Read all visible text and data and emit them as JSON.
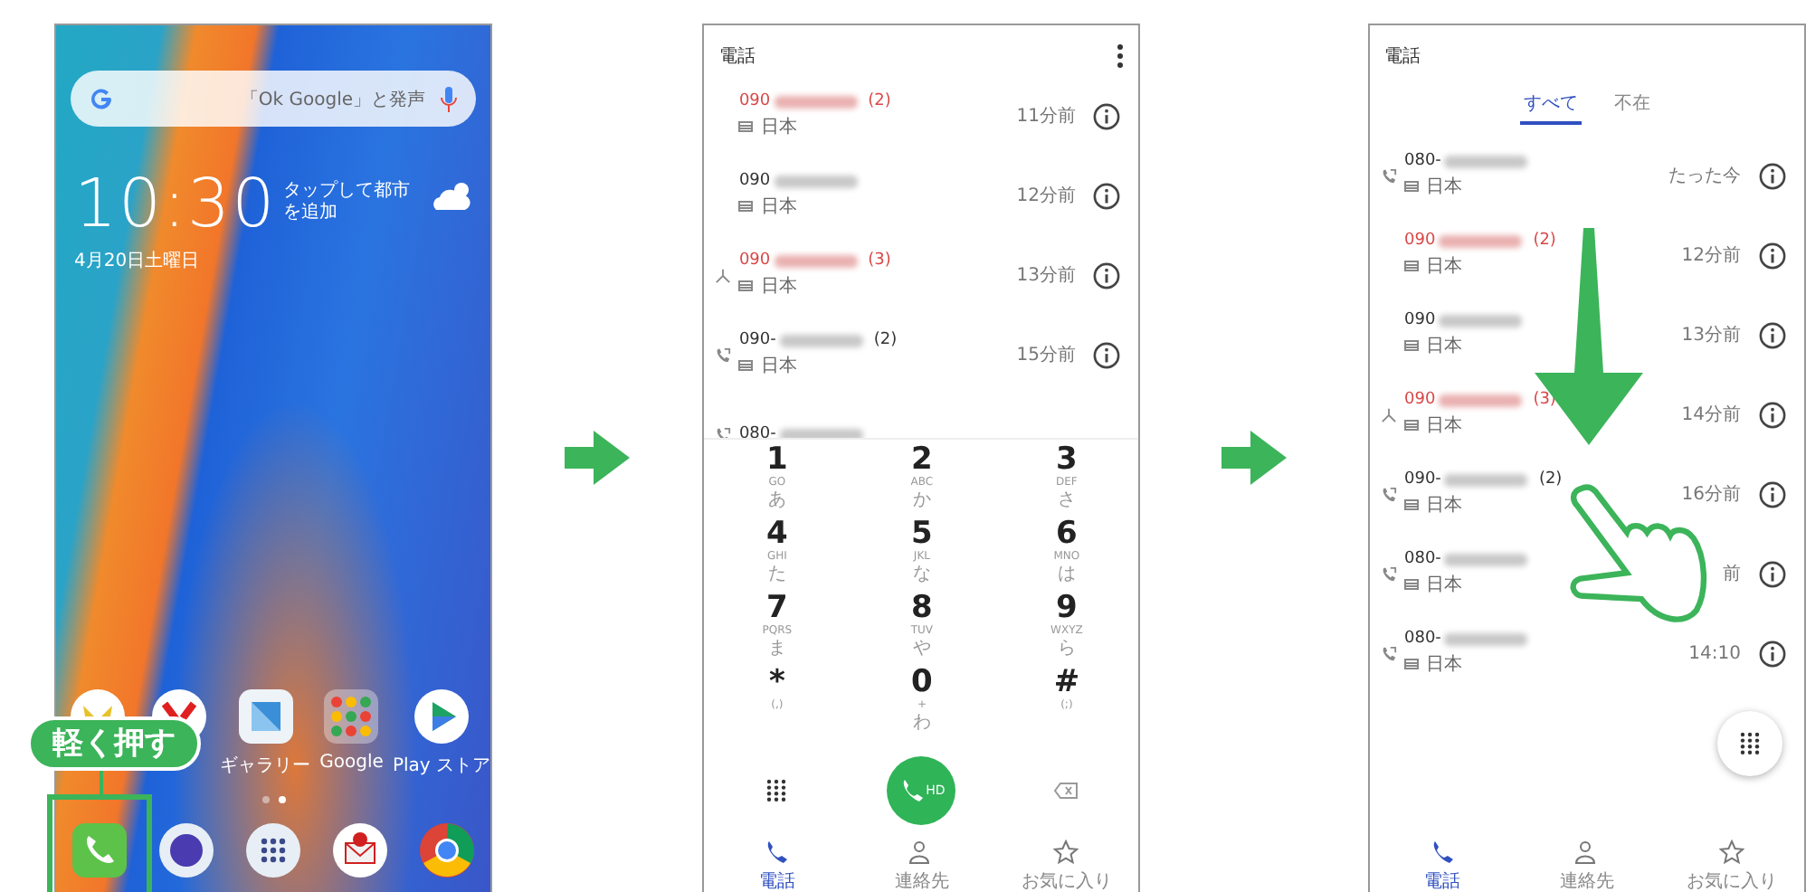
{
  "home_screen": {
    "search_placeholder": "「Ok Google」と発声",
    "clock": "10:30",
    "weather_hint": "タップして都市を追加",
    "date": "4月20日土曜日",
    "apps": [
      {
        "kind": "lock"
      },
      {
        "kind": "y"
      },
      {
        "kind": "gallery",
        "label": "ギャラリー"
      },
      {
        "kind": "folder",
        "label": "Google"
      },
      {
        "kind": "play",
        "label": "Play ストア"
      }
    ],
    "page_dots": [
      {
        "selected": false
      },
      {
        "selected": true
      }
    ],
    "dock": [
      {
        "kind": "phone"
      },
      {
        "kind": "camera"
      },
      {
        "kind": "apps"
      },
      {
        "kind": "mail"
      },
      {
        "kind": "browser"
      }
    ],
    "callout": "軽く押す"
  },
  "dialer_screen": {
    "title": "電話",
    "calls": [
      {
        "kind": "plain",
        "number": "090",
        "count": "(2)",
        "missed": true,
        "location": "日本",
        "time": "11分前"
      },
      {
        "kind": "plain",
        "number": "090",
        "missed": false,
        "location": "日本",
        "time": "12分前"
      },
      {
        "kind": "merged",
        "number": "090",
        "count": "(3)",
        "missed": true,
        "location": "日本",
        "time": "13分前"
      },
      {
        "kind": "outgoing",
        "number": "090-",
        "count": "(2)",
        "missed": false,
        "location": "日本",
        "time": "15分前"
      },
      {
        "kind": "outgoing",
        "number": "080-",
        "missed": false
      }
    ],
    "keys": [
      {
        "digit": "1",
        "letters": "GO",
        "kana": "あ"
      },
      {
        "digit": "2",
        "letters": "ABC",
        "kana": "か"
      },
      {
        "digit": "3",
        "letters": "DEF",
        "kana": "さ"
      },
      {
        "digit": "4",
        "letters": "GHI",
        "kana": "た"
      },
      {
        "digit": "5",
        "letters": "JKL",
        "kana": "な"
      },
      {
        "digit": "6",
        "letters": "MNO",
        "kana": "は"
      },
      {
        "digit": "7",
        "letters": "PQRS",
        "kana": "ま"
      },
      {
        "digit": "8",
        "letters": "TUV",
        "kana": "や"
      },
      {
        "digit": "9",
        "letters": "WXYZ",
        "kana": "ら"
      },
      {
        "digit": "*",
        "letters": "(,)"
      },
      {
        "digit": "0",
        "letters": "+",
        "kana": "わ"
      },
      {
        "digit": "#",
        "letters": "(;)"
      }
    ],
    "call_button": "HD",
    "nav": [
      {
        "kind": "phone",
        "label": "電話",
        "selected": true
      },
      {
        "kind": "contacts",
        "label": "連絡先",
        "selected": false
      },
      {
        "kind": "star",
        "label": "お気に入り",
        "selected": false
      }
    ]
  },
  "history_screen": {
    "title": "電話",
    "tabs": [
      {
        "label": "すべて",
        "selected": true
      },
      {
        "label": "不在",
        "selected": false
      }
    ],
    "calls": [
      {
        "kind": "outgoing",
        "number": "080-",
        "missed": false,
        "location": "日本",
        "time": "たった今"
      },
      {
        "kind": "plain",
        "number": "090",
        "count": "(2)",
        "missed": true,
        "location": "日本",
        "time": "12分前"
      },
      {
        "kind": "plain",
        "number": "090",
        "missed": false,
        "location": "日本",
        "time": "13分前"
      },
      {
        "kind": "merged",
        "number": "090",
        "count": "(3)",
        "missed": true,
        "location": "日本",
        "time": "14分前"
      },
      {
        "kind": "outgoing",
        "number": "090-",
        "count": "(2)",
        "missed": false,
        "location": "日本",
        "time": "16分前"
      },
      {
        "kind": "outgoing",
        "number": "080-",
        "missed": false,
        "location": "日本",
        "time": "前"
      },
      {
        "kind": "outgoing",
        "number": "080-",
        "missed": false,
        "location": "日本",
        "time": "14:10"
      }
    ],
    "nav": [
      {
        "kind": "phone",
        "label": "電話",
        "selected": true
      },
      {
        "kind": "contacts",
        "label": "連絡先",
        "selected": false
      },
      {
        "kind": "star",
        "label": "お気に入り",
        "selected": false
      }
    ]
  }
}
